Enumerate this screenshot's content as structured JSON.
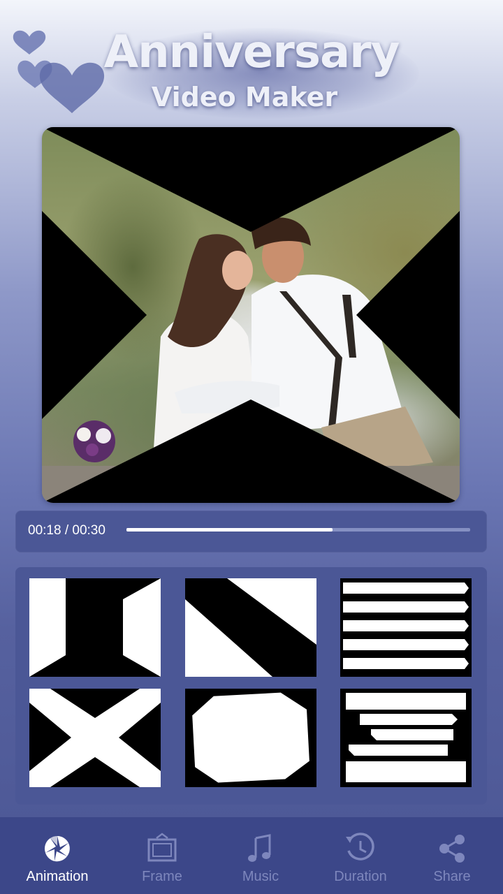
{
  "header": {
    "title": "Anniversary",
    "subtitle": "Video Maker"
  },
  "player": {
    "time_label": "00:18 / 00:30",
    "progress_fraction": 0.6
  },
  "animations": [
    {
      "id": "hourglass"
    },
    {
      "id": "diagonal"
    },
    {
      "id": "stripes"
    },
    {
      "id": "x-cross"
    },
    {
      "id": "hexagon"
    },
    {
      "id": "offset-bars"
    }
  ],
  "nav": {
    "items": [
      {
        "label": "Animation",
        "icon": "shutter-icon",
        "active": true
      },
      {
        "label": "Frame",
        "icon": "frame-icon",
        "active": false
      },
      {
        "label": "Music",
        "icon": "music-note-icon",
        "active": false
      },
      {
        "label": "Duration",
        "icon": "clock-icon",
        "active": false
      },
      {
        "label": "Share",
        "icon": "share-icon",
        "active": false
      }
    ]
  },
  "colors": {
    "card": "#4b5796",
    "nav_bar": "#3c4789",
    "inactive_label": "#7e87bd",
    "active_label": "#ffffff"
  }
}
